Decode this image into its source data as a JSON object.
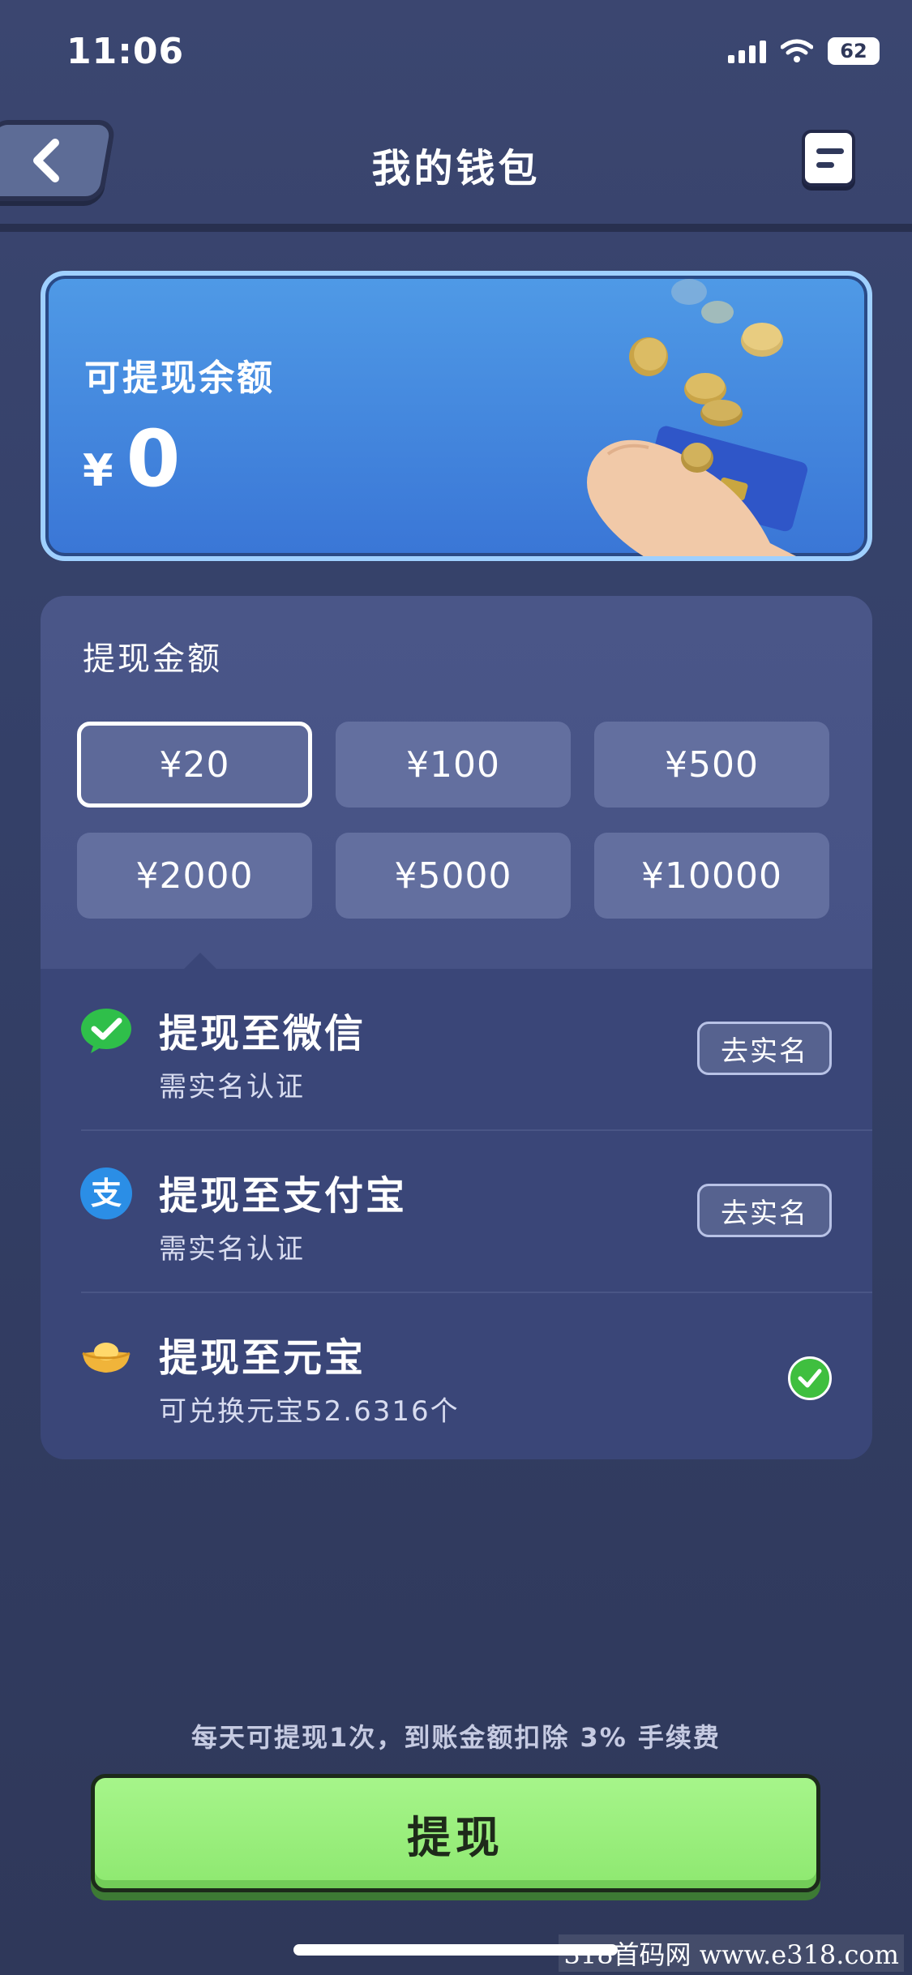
{
  "status_bar": {
    "time": "11:06",
    "battery": "62"
  },
  "header": {
    "title": "我的钱包"
  },
  "balance": {
    "label": "可提现余额",
    "currency": "¥",
    "amount": "0"
  },
  "withdraw": {
    "title": "提现金额",
    "options": [
      "¥20",
      "¥100",
      "¥500",
      "¥2000",
      "¥5000",
      "¥10000"
    ],
    "selected_option": "¥20"
  },
  "methods": [
    {
      "title": "提现至微信",
      "subtitle": "需实名认证",
      "action": "去实名",
      "icon": "wechat-icon"
    },
    {
      "title": "提现至支付宝",
      "subtitle": "需实名认证",
      "action": "去实名",
      "icon": "alipay-icon"
    },
    {
      "title": "提现至元宝",
      "subtitle": "可兑换元宝52.6316个",
      "icon": "gold-ingot-icon",
      "selected": true
    }
  ],
  "footer": {
    "fee_note": "每天可提现1次，到账金额扣除 3% 手续费",
    "withdraw_button": "提现"
  },
  "watermark": "318首码网 www.e318.com",
  "colors": {
    "accent_green": "#9ef07f",
    "card_blue": "#3f86df",
    "background": "#343f68"
  }
}
